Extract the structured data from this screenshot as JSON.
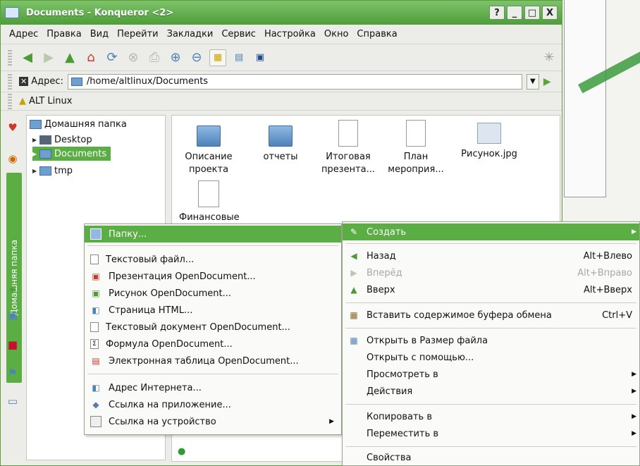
{
  "window": {
    "title": "Documents - Konqueror <2>",
    "buttons": {
      "help": "?",
      "minimize": "_",
      "maximize": "□",
      "close": "X"
    }
  },
  "menubar": [
    "Адрес",
    "Правка",
    "Вид",
    "Перейти",
    "Закладки",
    "Сервис",
    "Настройка",
    "Окно",
    "Справка"
  ],
  "toolbar": {
    "icons": [
      "back-icon",
      "forward-icon",
      "up-icon",
      "home-icon",
      "reload-icon",
      "stop-icon",
      "print-icon",
      "zoom-in-icon",
      "zoom-out-icon",
      "icon-view-icon",
      "detail-view-icon",
      "preview-icon"
    ]
  },
  "addressbar": {
    "label": "Адрес:",
    "value": "/home/altlinux/Documents"
  },
  "bookmarks": {
    "item": "ALT Linux"
  },
  "sidepanel": {
    "tab_label": "Домашняя папка"
  },
  "tree": {
    "root": "Домашняя папка",
    "children": [
      "Desktop",
      "Documents",
      "tmp"
    ]
  },
  "files": [
    {
      "name": "Описание проекта",
      "line1": "Описание",
      "line2": "проекта",
      "kind": "folder"
    },
    {
      "name": "отчеты",
      "line1": "отчеты",
      "line2": "",
      "kind": "folder"
    },
    {
      "name": "Итоговая презента...",
      "line1": "Итоговая",
      "line2": "презента...",
      "kind": "presentation"
    },
    {
      "name": "План мероприя...",
      "line1": "План",
      "line2": "мероприя...",
      "kind": "document"
    },
    {
      "name": "Рисунок.jpg",
      "line1": "Рисунок.jpg",
      "line2": "",
      "kind": "image"
    },
    {
      "name": "Финансовые",
      "line1": "Финансовые",
      "line2": "",
      "kind": "spreadsheet"
    }
  ],
  "create_submenu": [
    {
      "label": "Папку...",
      "icon": "folder-icon",
      "highlighted": true
    },
    {
      "label": "Текстовый файл...",
      "icon": "text-file-icon"
    },
    {
      "label": "Презентация OpenDocument...",
      "icon": "presentation-icon"
    },
    {
      "label": "Рисунок OpenDocument...",
      "icon": "drawing-icon"
    },
    {
      "label": "Страница HTML...",
      "icon": "html-icon"
    },
    {
      "label": "Текстовый документ OpenDocument...",
      "icon": "text-document-icon"
    },
    {
      "label": "Формула OpenDocument...",
      "icon": "formula-icon"
    },
    {
      "label": "Электронная таблица OpenDocument...",
      "icon": "spreadsheet-icon"
    },
    {
      "label": "Адрес Интернета...",
      "icon": "url-icon"
    },
    {
      "label": "Ссылка на приложение...",
      "icon": "app-link-icon"
    },
    {
      "label": "Ссылка на устройство",
      "icon": "device-link-icon",
      "submenu": true
    }
  ],
  "context_menu": [
    {
      "label": "Создать",
      "highlighted": true,
      "submenu": true
    },
    {
      "label": "Назад",
      "accel": "Alt+Влево"
    },
    {
      "label": "Вперёд",
      "accel": "Alt+Вправо",
      "disabled": true
    },
    {
      "label": "Вверх",
      "accel": "Alt+Вверх"
    },
    {
      "label": "Вставить содержимое буфера обмена",
      "accel": "Ctrl+V"
    },
    {
      "label": "Открыть в Размер файла"
    },
    {
      "label": "Открыть с помощью..."
    },
    {
      "label": "Просмотреть в",
      "submenu": true
    },
    {
      "label": "Действия",
      "submenu": true
    },
    {
      "label": "Копировать в",
      "submenu": true
    },
    {
      "label": "Переместить в",
      "submenu": true
    },
    {
      "label": "Свойства"
    }
  ],
  "colors": {
    "accent": "#5aae44",
    "title_green": "#4f9d3a",
    "folder": "#6d9fd0"
  }
}
